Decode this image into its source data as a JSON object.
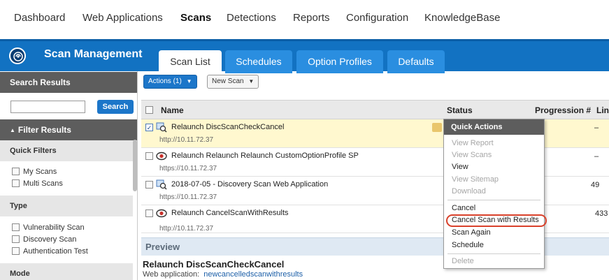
{
  "topnav": {
    "items": [
      "Dashboard",
      "Web Applications",
      "Scans",
      "Detections",
      "Reports",
      "Configuration",
      "KnowledgeBase"
    ],
    "active": "Scans"
  },
  "header": {
    "title": "Scan Management",
    "tabs": [
      "Scan List",
      "Schedules",
      "Option Profiles",
      "Defaults"
    ],
    "active_tab": "Scan List"
  },
  "sidebar": {
    "search_results_label": "Search Results",
    "search_button": "Search",
    "search_value": "",
    "filter_results_label": "Filter Results",
    "quick_filters_label": "Quick Filters",
    "quick_filters": [
      "My Scans",
      "Multi Scans"
    ],
    "type_label": "Type",
    "types": [
      "Vulnerability Scan",
      "Discovery Scan",
      "Authentication Test"
    ],
    "mode_label": "Mode"
  },
  "toolbar": {
    "actions_label": "Actions (1)",
    "new_scan_label": "New Scan"
  },
  "grid": {
    "columns": [
      "Name",
      "Status",
      "Progression #",
      "Lin"
    ],
    "rows": [
      {
        "name": "Relaunch DiscScanCheckCancel",
        "url": "http://10.11.72.37",
        "progression": "–",
        "selected": true,
        "icon": "discovery-scan-icon"
      },
      {
        "name": "Relaunch Relaunch Relaunch CustomOptionProfile SP",
        "url": "https://10.11.72.37",
        "progression": "–",
        "selected": false,
        "icon": "vulnerability-scan-icon"
      },
      {
        "name": "2018-07-05 - Discovery Scan Web Application",
        "url": "https://10.11.72.37",
        "progression": "49",
        "selected": false,
        "icon": "discovery-scan-icon"
      },
      {
        "name": "Relaunch CancelScanWithResults",
        "url": "http://10.11.72.37",
        "progression": "433",
        "selected": false,
        "icon": "vulnerability-scan-icon"
      }
    ]
  },
  "preview": {
    "label": "Preview",
    "name": "Relaunch DiscScanCheckCancel",
    "web_app_label": "Web application:",
    "web_app_value": "newcancelledscanwithresults"
  },
  "quick_actions": {
    "title": "Quick Actions",
    "items": [
      {
        "label": "View Report",
        "disabled": true
      },
      {
        "label": "View Scans",
        "disabled": true
      },
      {
        "label": "View",
        "disabled": false
      },
      {
        "label": "View Sitemap",
        "disabled": true
      },
      {
        "label": "Download",
        "disabled": true
      },
      {
        "label": "Cancel",
        "disabled": false
      },
      {
        "label": "Cancel Scan with Results",
        "disabled": false,
        "highlighted": true
      },
      {
        "label": "Scan Again",
        "disabled": false
      },
      {
        "label": "Schedule",
        "disabled": false
      },
      {
        "label": "Delete",
        "disabled": true
      }
    ]
  },
  "colors": {
    "brand_blue": "#1272c2",
    "tab_blue": "#2a8ee0",
    "selected_row": "#fff8cf",
    "highlight_ring": "#d9412b"
  }
}
